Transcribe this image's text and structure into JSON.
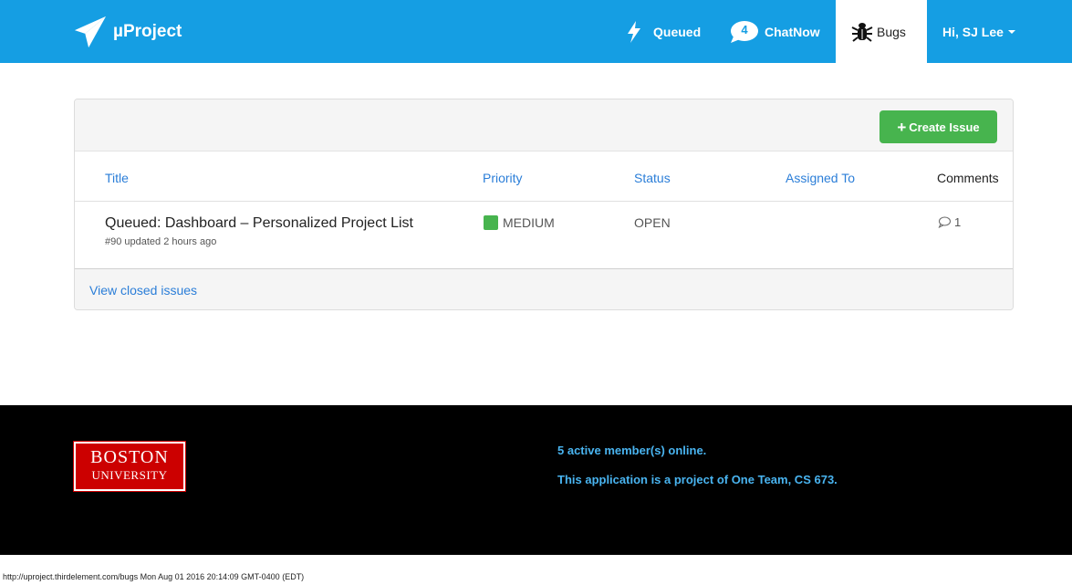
{
  "navbar": {
    "brand": "µProject",
    "queued_label": "Queued",
    "chat_count": "4",
    "chat_label": "ChatNow",
    "bugs_label": "Bugs",
    "user_label": "Hi, SJ Lee",
    "colors": {
      "bar": "#159ee3",
      "active_tab": "#ffffff"
    }
  },
  "panel": {
    "create_button": "Create Issue",
    "columns": {
      "title": "Title",
      "priority": "Priority",
      "status": "Status",
      "assigned": "Assigned To",
      "comments": "Comments"
    },
    "issues": [
      {
        "title": "Queued: Dashboard – Personalized Project List",
        "meta": "#90 updated 2 hours ago",
        "priority": "MEDIUM",
        "priority_color": "#47b44e",
        "status": "OPEN",
        "assigned": "",
        "comments": "1"
      }
    ],
    "view_closed": "View closed issues"
  },
  "footer": {
    "logo_line1": "BOSTON",
    "logo_line2": "UNIVERSITY",
    "members_online": "5 active member(s) online.",
    "project_note": "This application is a project of One Team, CS 673."
  },
  "status_bar": "http://uproject.thirdelement.com/bugs Mon Aug 01 2016 20:14:09 GMT-0400 (EDT)"
}
